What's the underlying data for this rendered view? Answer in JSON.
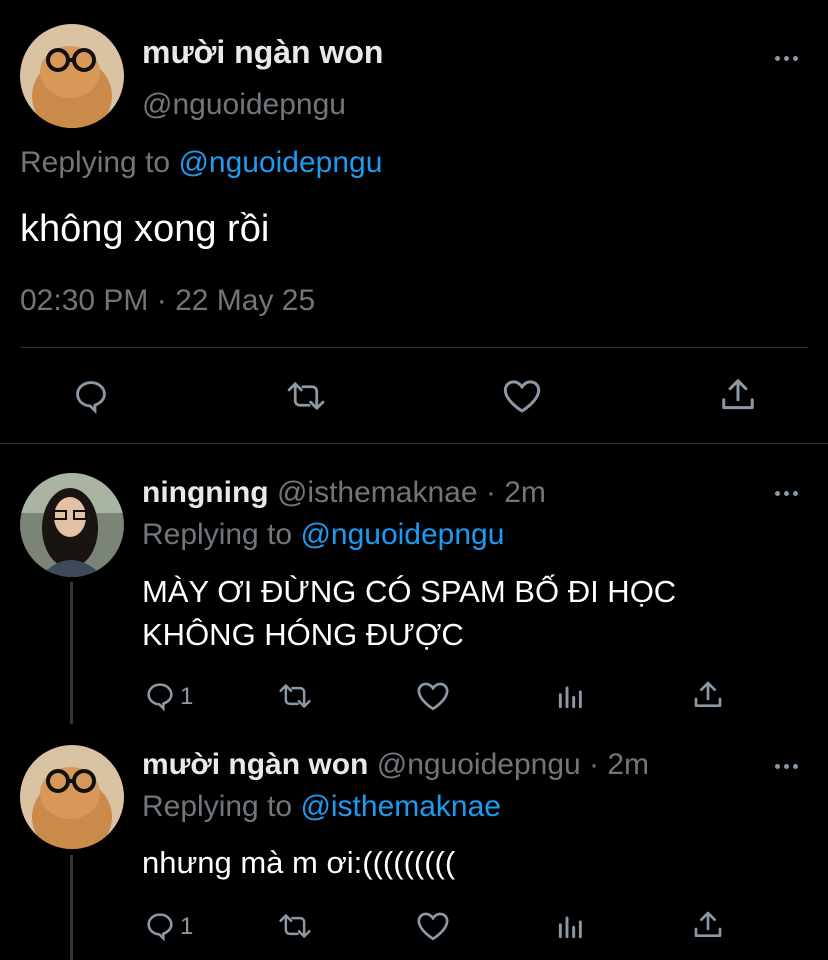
{
  "main_tweet": {
    "display_name": "mười ngàn won",
    "handle": "@nguoidepngu",
    "replying_prefix": "Replying to ",
    "replying_to": "@nguoidepngu",
    "text": "không xong rồi",
    "timestamp": "02:30 PM · 22 May 25",
    "actions": [
      "reply-icon",
      "retweet-icon",
      "like-icon",
      "share-icon"
    ]
  },
  "replies": [
    {
      "display_name": "ningning",
      "handle": "@isthemaknae",
      "time": " · 2m",
      "replying_prefix": "Replying to ",
      "replying_to": "@nguoidepngu",
      "text_line1": "MÀY ƠI ĐỪNG CÓ SPAM BỐ ĐI HỌC",
      "text_line2": "KHÔNG HÓNG ĐƯỢC",
      "reply_count": "1"
    },
    {
      "display_name": "mười ngàn won",
      "handle": "@nguoidepngu",
      "time": " · 2m",
      "replying_prefix": "Replying to ",
      "replying_to": "@isthemaknae",
      "text_line1": "nhưng mà m ơi:(((((((((",
      "reply_count": "1"
    }
  ],
  "colors": {
    "background": "#000000",
    "text": "#e7e9ea",
    "muted": "#71767b",
    "link": "#1d9bf0",
    "divider": "#2f3336"
  }
}
